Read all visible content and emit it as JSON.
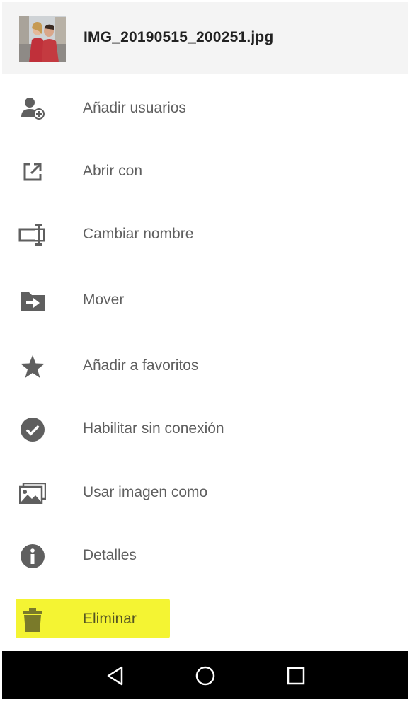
{
  "header": {
    "file_name": "IMG_20190515_200251.jpg",
    "thumbnail": "photo-thumbnail"
  },
  "menu": {
    "items": [
      {
        "label": "Añadir usuarios",
        "icon": "add-person-icon"
      },
      {
        "label": "Abrir con",
        "icon": "open-external-icon"
      },
      {
        "label": "Cambiar nombre",
        "icon": "rename-icon"
      },
      {
        "label": "Mover",
        "icon": "move-folder-icon"
      },
      {
        "label": "Añadir a favoritos",
        "icon": "star-icon"
      },
      {
        "label": "Habilitar sin conexión",
        "icon": "offline-check-icon"
      },
      {
        "label": "Usar imagen como",
        "icon": "image-icon"
      },
      {
        "label": "Detalles",
        "icon": "info-icon"
      },
      {
        "label": "Eliminar",
        "icon": "trash-icon",
        "highlighted": true
      }
    ]
  },
  "navbar": {
    "buttons": [
      "back-icon",
      "home-icon",
      "recents-icon"
    ]
  },
  "colors": {
    "header_bg": "#f4f4f4",
    "icon": "#5f5f5f",
    "highlight": "#f4f433",
    "delete_icon": "#7a7a2a",
    "navbar": "#000000"
  }
}
